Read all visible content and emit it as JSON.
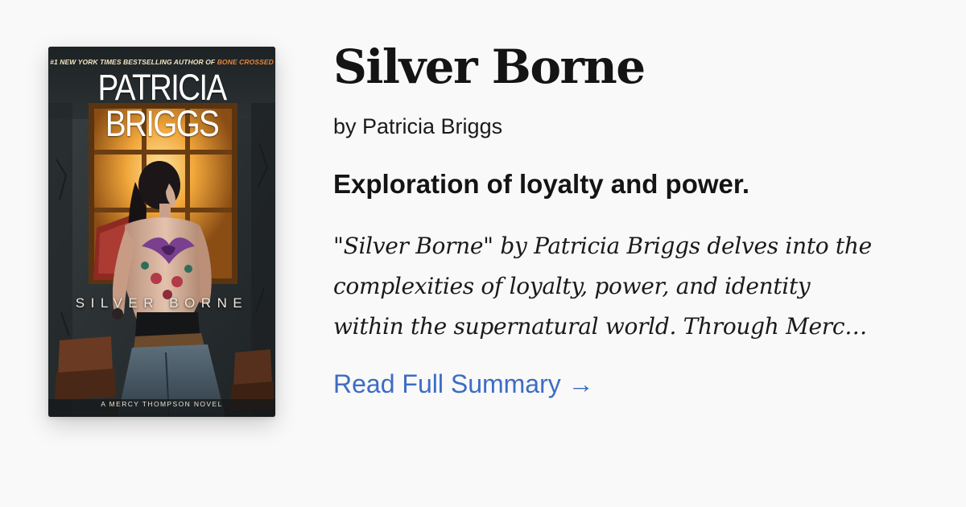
{
  "book": {
    "title": "Silver Borne",
    "byline": "by Patricia Briggs",
    "tagline": "Exploration of loyalty and power.",
    "summary_lines": [
      "\"Silver Borne\" by Patricia Briggs delves into the",
      "complexities of loyalty, power, and identity",
      "within the supernatural world. Through Merc…"
    ],
    "read_more_label": "Read Full Summary →"
  },
  "cover": {
    "tagline_prefix": "#1 NEW YORK TIMES BESTSELLING AUTHOR OF ",
    "tagline_book": "BONE CROSSED",
    "author": "PATRICIA BRIGGS",
    "book_title": "SILVER BORNE",
    "series": "A MERCY THOMPSON NOVEL"
  },
  "colors": {
    "background": "#f9f9f9",
    "text": "#141414",
    "link": "#3d6cc4"
  }
}
